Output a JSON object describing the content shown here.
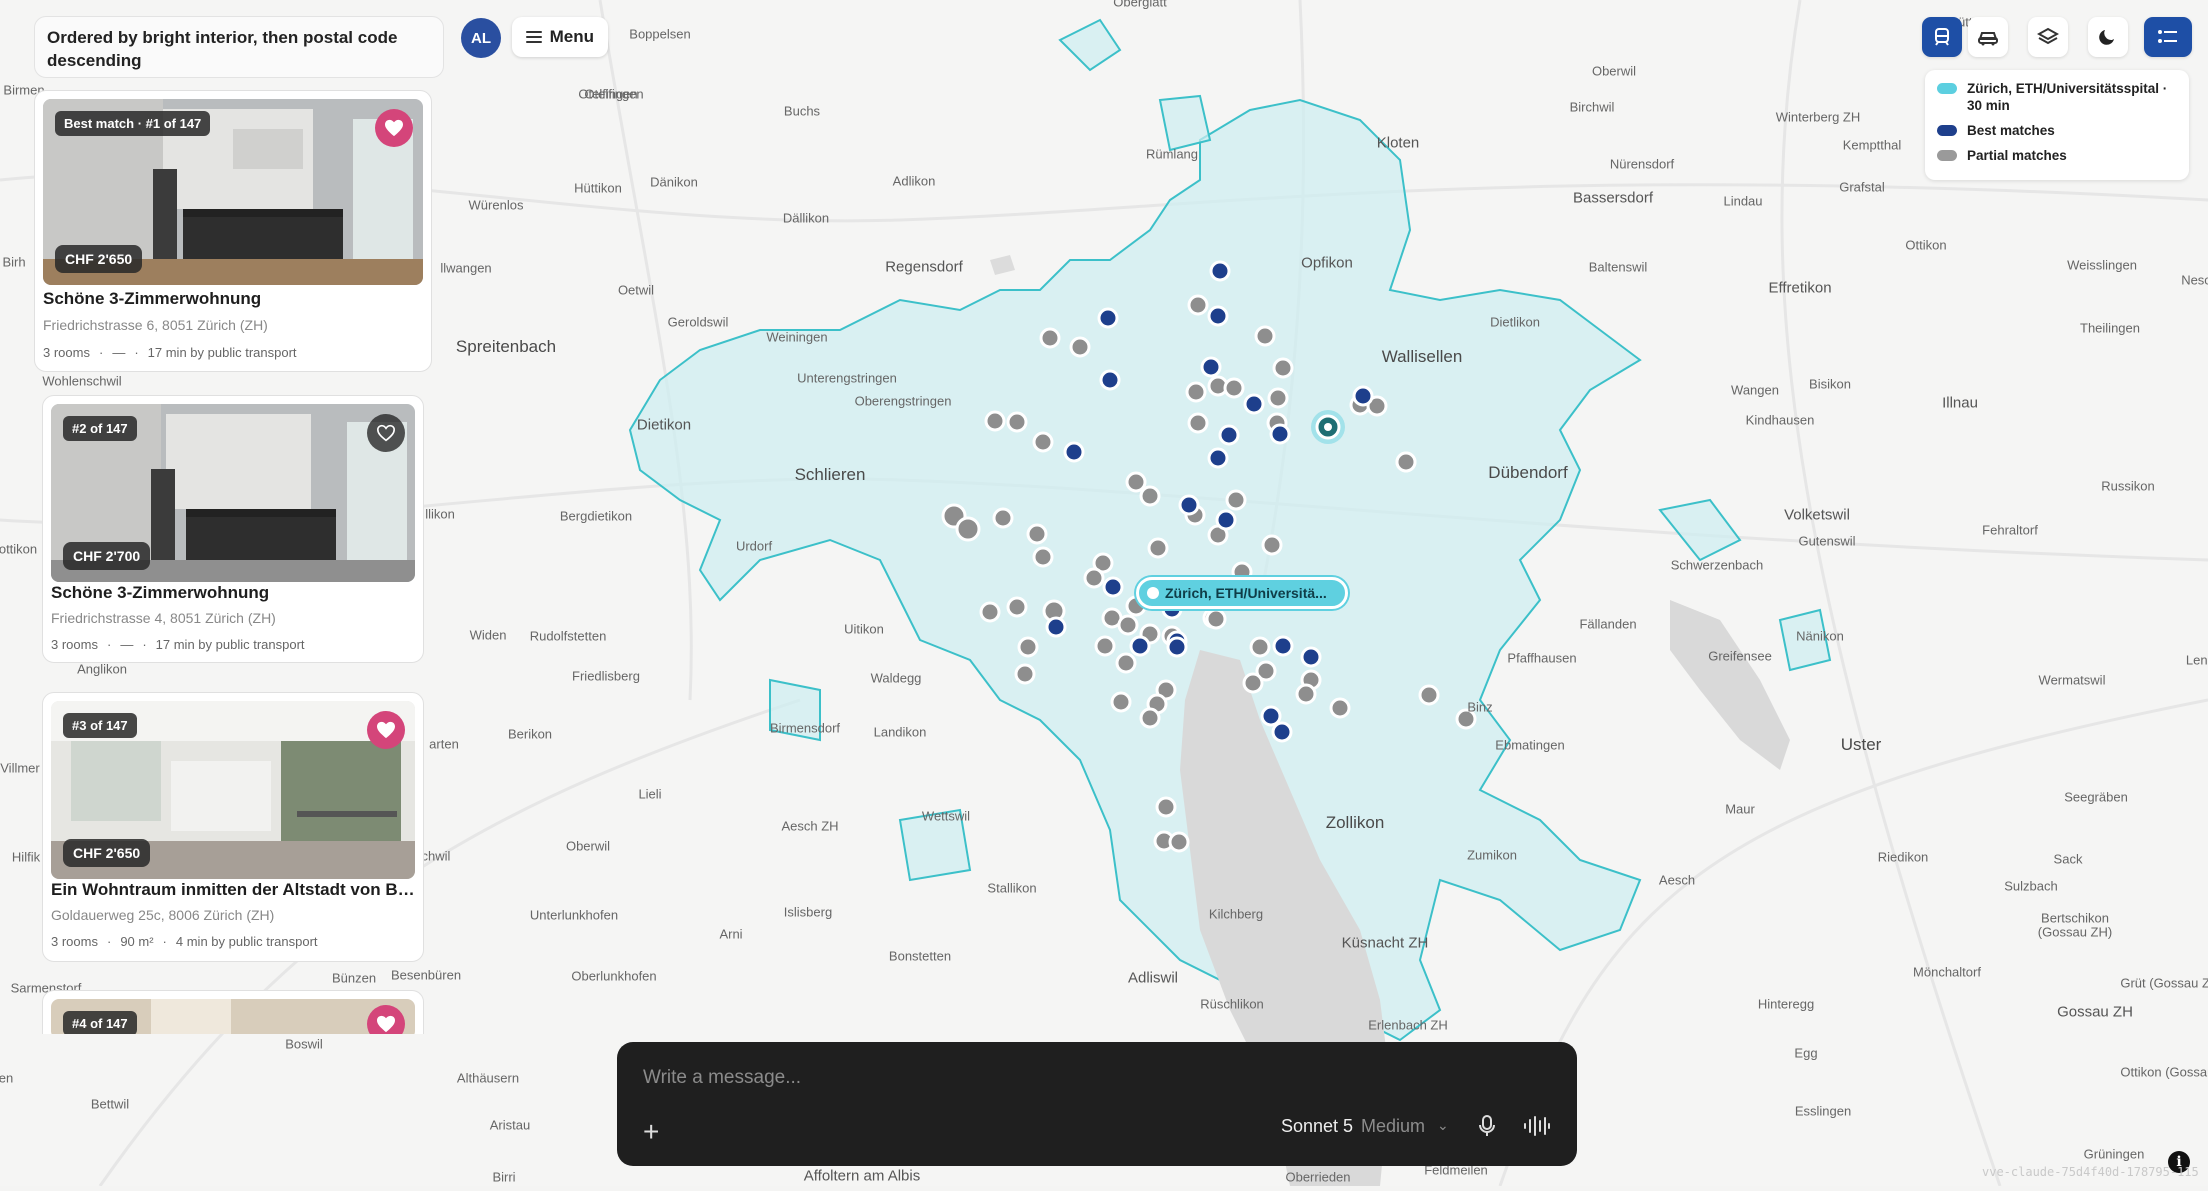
{
  "sort_label": "Ordered by bright interior, then postal code descending",
  "avatar_initials": "AL",
  "menu_label": "Menu",
  "listings": [
    {
      "badge": "Best match · #1 of 147",
      "price": "CHF 2'650",
      "title": "Schöne 3-Zimmerwohnung",
      "address": "Friedrichstrasse 6, 8051 Zürich (ZH)",
      "rooms": "3 rooms",
      "sep": "·",
      "area": "—",
      "transit": "17 min by public transport",
      "favorite": true
    },
    {
      "badge": "#2 of 147",
      "price": "CHF 2'700",
      "title": "Schöne 3-Zimmerwohnung",
      "address": "Friedrichstrasse 4, 8051 Zürich (ZH)",
      "rooms": "3 rooms",
      "sep": "·",
      "area": "—",
      "transit": "17 min by public transport",
      "favorite": false
    },
    {
      "badge": "#3 of 147",
      "price": "CHF 2'650",
      "title": "Ein Wohntraum inmitten der Altstadt von Bü...",
      "address": "Goldauerweg 25c, 8006 Zürich (ZH)",
      "rooms": "3 rooms",
      "sep": "·",
      "area": "90 m²",
      "transit": "4 min by public transport",
      "favorite": true
    },
    {
      "badge": "#4 of 147",
      "favorite": true
    }
  ],
  "legend": [
    {
      "label": "Zürich, ETH/Universitätsspital · 30 min",
      "color": "#5ccfe0"
    },
    {
      "label": "Best matches",
      "color": "#1e3f8c"
    },
    {
      "label": "Partial matches",
      "color": "#9a9a9a"
    }
  ],
  "map_tooltip": "Zürich, ETH/Universitä...",
  "chat": {
    "placeholder": "Write a message...",
    "model": "Sonnet 5",
    "effort": "Medium"
  },
  "version": "vve-claude-75d4f40d-178795-115",
  "colors": {
    "accent": "#1e4fa6",
    "isochrone": "#5ccfe0",
    "favorite": "#d4457a"
  },
  "places": [
    [
      "Oberglatt",
      1140,
      2,
      "s"
    ],
    [
      "Brütten",
      1966,
      22,
      "s"
    ],
    [
      "Boppelsen",
      660,
      34,
      "s"
    ],
    [
      "Oberwil",
      1614,
      71,
      "s"
    ],
    [
      "Otelfingen",
      608,
      94,
      "s"
    ],
    [
      "Buchs",
      802,
      111,
      "s"
    ],
    [
      "Birchwil",
      1592,
      107,
      "s"
    ],
    [
      "Winterberg ZH",
      1818,
      117,
      "s"
    ],
    [
      "Kloten",
      1398,
      143,
      "m"
    ],
    [
      "Rümlang",
      1172,
      154,
      "s"
    ],
    [
      "Nürensdorf",
      1642,
      164,
      "s"
    ],
    [
      "Kemptthal",
      1872,
      145,
      "s"
    ],
    [
      "Hüttikon",
      598,
      188,
      "s"
    ],
    [
      "Dänikon",
      674,
      182,
      "s"
    ],
    [
      "Adlikon",
      914,
      181,
      "s"
    ],
    [
      "Bassersdorf",
      1613,
      198,
      "m"
    ],
    [
      "Grafstal",
      1862,
      187,
      "s"
    ],
    [
      "Würenlos",
      496,
      205,
      "s"
    ],
    [
      "Dällikon",
      806,
      218,
      "s"
    ],
    [
      "Lindau",
      1743,
      201,
      "s"
    ],
    [
      "Ottikon",
      1926,
      245,
      "s"
    ],
    [
      "Regensdorf",
      924,
      267,
      "m"
    ],
    [
      "Opfikon",
      1327,
      263,
      "m"
    ],
    [
      "Baltenswil",
      1618,
      267,
      "s"
    ],
    [
      "Weisslingen",
      2102,
      265,
      "s"
    ],
    [
      "Otelfingen",
      614,
      94,
      "s"
    ],
    [
      "Oetwil",
      636,
      290,
      "s"
    ],
    [
      "Effretikon",
      1800,
      288,
      "m"
    ],
    [
      "Geroldswil",
      698,
      322,
      "s"
    ],
    [
      "Weiningen",
      797,
      337,
      "s"
    ],
    [
      "Dietlikon",
      1515,
      322,
      "s"
    ],
    [
      "Theilingen",
      2110,
      328,
      "s"
    ],
    [
      "Spreitenbach",
      506,
      347,
      "b"
    ],
    [
      "Wallisellen",
      1422,
      357,
      "b"
    ],
    [
      "Unterengstringen",
      847,
      378,
      "s"
    ],
    [
      "Oberengstringen",
      903,
      401,
      "s"
    ],
    [
      "Wangen",
      1755,
      390,
      "s"
    ],
    [
      "Bisikon",
      1830,
      384,
      "s"
    ],
    [
      "Illnau",
      1960,
      403,
      "m"
    ],
    [
      "Dietikon",
      664,
      425,
      "m"
    ],
    [
      "Kindhausen",
      1780,
      420,
      "s"
    ],
    [
      "Schlieren",
      830,
      475,
      "b"
    ],
    [
      "Dübendorf",
      1528,
      473,
      "b"
    ],
    [
      "Russikon",
      2128,
      486,
      "s"
    ],
    [
      "Bergdietikon",
      596,
      516,
      "s"
    ],
    [
      "Volketswil",
      1817,
      515,
      "m"
    ],
    [
      "Urdorf",
      754,
      546,
      "s"
    ],
    [
      "Fehraltorf",
      2010,
      530,
      "s"
    ],
    [
      "Gutenswil",
      1827,
      541,
      "s"
    ],
    [
      "Schwerzenbach",
      1717,
      565,
      "s"
    ],
    [
      "Uitikon",
      864,
      629,
      "s"
    ],
    [
      "Widen",
      488,
      635,
      "s"
    ],
    [
      "Rudolfstetten",
      568,
      636,
      "s"
    ],
    [
      "Fällanden",
      1608,
      624,
      "s"
    ],
    [
      "Nänikon",
      1820,
      636,
      "s"
    ],
    [
      "Waldegg",
      896,
      678,
      "s"
    ],
    [
      "Pfaffhausen",
      1542,
      658,
      "s"
    ],
    [
      "Greifensee",
      1740,
      656,
      "s"
    ],
    [
      "Wermatswil",
      2072,
      680,
      "s"
    ],
    [
      "Friedlisberg",
      606,
      676,
      "s"
    ],
    [
      "Binz",
      1480,
      707,
      "s"
    ],
    [
      "Birmensdorf",
      805,
      728,
      "s"
    ],
    [
      "Landikon",
      900,
      732,
      "s"
    ],
    [
      "Berikon",
      530,
      734,
      "s"
    ],
    [
      "Ebmatingen",
      1530,
      745,
      "s"
    ],
    [
      "Uster",
      1861,
      745,
      "b"
    ],
    [
      "Aesch ZH",
      810,
      826,
      "s"
    ],
    [
      "Wettswil",
      946,
      816,
      "s"
    ],
    [
      "Oberwil",
      588,
      846,
      "s"
    ],
    [
      "Lieli",
      650,
      794,
      "s"
    ],
    [
      "Seegräben",
      2096,
      797,
      "s"
    ],
    [
      "Zollikon",
      1355,
      823,
      "b"
    ],
    [
      "Maur",
      1740,
      809,
      "s"
    ],
    [
      "Zumikon",
      1492,
      855,
      "s"
    ],
    [
      "Riedikon",
      1903,
      857,
      "s"
    ],
    [
      "Sack",
      2068,
      859,
      "s"
    ],
    [
      "Stallikon",
      1012,
      888,
      "s"
    ],
    [
      "Aesch",
      1677,
      880,
      "s"
    ],
    [
      "Sulzbach",
      2031,
      886,
      "s"
    ],
    [
      "Unterlunkhofen",
      574,
      915,
      "s"
    ],
    [
      "Islisberg",
      808,
      912,
      "s"
    ],
    [
      "Kilchberg",
      1236,
      914,
      "s"
    ],
    [
      "Bertschikon",
      2075,
      918,
      "s"
    ],
    [
      "(Gossau ZH)",
      2075,
      932,
      "s"
    ],
    [
      "Arni",
      731,
      934,
      "s"
    ],
    [
      "Küsnacht ZH",
      1385,
      943,
      "m"
    ],
    [
      "Bonstetten",
      920,
      956,
      "s"
    ],
    [
      "Oberlunkhofen",
      614,
      976,
      "s"
    ],
    [
      "Mönchaltorf",
      1947,
      972,
      "s"
    ],
    [
      "Bünzen",
      354,
      978,
      "s"
    ],
    [
      "Besenbüren",
      426,
      975,
      "s"
    ],
    [
      "Adliswil",
      1153,
      978,
      "m"
    ],
    [
      "Grüt (Gossau ZH)",
      2172,
      983,
      "s"
    ],
    [
      "Sarmenstorf",
      46,
      988,
      "s"
    ],
    [
      "Rüschlikon",
      1232,
      1004,
      "s"
    ],
    [
      "Hinteregg",
      1786,
      1004,
      "s"
    ],
    [
      "Gossau ZH",
      2095,
      1012,
      "m"
    ],
    [
      "Erlenbach ZH",
      1408,
      1025,
      "s"
    ],
    [
      "Boswil",
      304,
      1044,
      "s"
    ],
    [
      "Egg",
      1806,
      1053,
      "s"
    ],
    [
      "Althäusern",
      488,
      1078,
      "s"
    ],
    [
      "Ottikon (Gossau ZH)",
      2180,
      1072,
      "s"
    ],
    [
      "Bettwil",
      110,
      1104,
      "s"
    ],
    [
      "Esslingen",
      1823,
      1111,
      "s"
    ],
    [
      "Aristau",
      510,
      1125,
      "s"
    ],
    [
      "Grüningen",
      2114,
      1154,
      "s"
    ],
    [
      "Birri",
      504,
      1177,
      "s"
    ],
    [
      "Affoltern am Albis",
      862,
      1176,
      "m"
    ],
    [
      "Oberrieden",
      1318,
      1177,
      "s"
    ],
    [
      "Feldmeilen",
      1456,
      1170,
      "s"
    ],
    [
      "Birmen",
      24,
      90,
      "s"
    ],
    [
      "Birh",
      14,
      262,
      "s"
    ],
    [
      "llwangen",
      466,
      268,
      "s"
    ],
    [
      "Wohlenschwil",
      82,
      381,
      "s"
    ],
    [
      "llikon",
      440,
      514,
      "s"
    ],
    [
      "ottikon",
      18,
      549,
      "s"
    ],
    [
      "Anglikon",
      102,
      669,
      "s"
    ],
    [
      "arten",
      444,
      744,
      "s"
    ],
    [
      "Villmer",
      20,
      768,
      "s"
    ],
    [
      "Hilfik",
      26,
      857,
      "s"
    ],
    [
      "chwil",
      436,
      856,
      "s"
    ],
    [
      "Nesc",
      2196,
      280,
      "s"
    ],
    [
      "Lenz",
      2200,
      660,
      "s"
    ],
    [
      "en",
      6,
      1078,
      "s"
    ]
  ]
}
